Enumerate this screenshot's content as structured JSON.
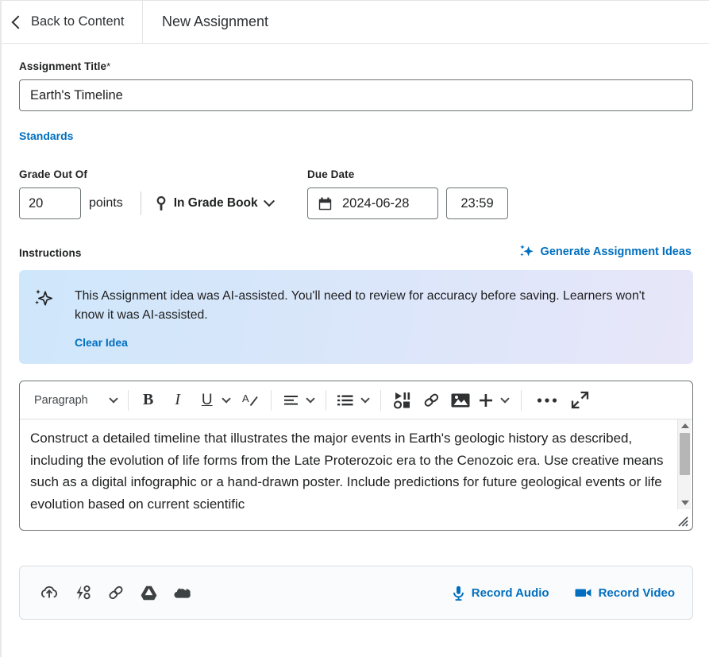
{
  "header": {
    "back_label": "Back to Content",
    "title": "New Assignment",
    "back_icon": "chevron-left-icon"
  },
  "form": {
    "title_label": "Assignment Title",
    "title_required_marker": "*",
    "title_value": "Earth's Timeline",
    "title_placeholder": "",
    "standards_link": "Standards",
    "grade_label": "Grade Out Of",
    "grade_value": "20",
    "points_label": "points",
    "gradebook_label": "In Grade Book",
    "gradebook_icon": "pin-icon",
    "gradebook_caret": "chevron-down-icon",
    "due_date_label": "Due Date",
    "due_date_value": "2024-06-28",
    "due_date_icon": "calendar-icon",
    "due_time_value": "23:59",
    "instructions_label": "Instructions",
    "generate_ideas_label": "Generate Assignment Ideas",
    "generate_ideas_icon": "sparkle-icon"
  },
  "ai_banner": {
    "icon": "sparkle-icon",
    "message": "This Assignment idea was AI-assisted. You'll need to review for accuracy before saving. Learners won't know it was AI-assisted.",
    "clear_link": "Clear Idea"
  },
  "editor": {
    "style_select_value": "Paragraph",
    "toolbar": [
      {
        "name": "bold-button",
        "label": "B"
      },
      {
        "name": "italic-button",
        "label": "I"
      },
      {
        "name": "underline-button",
        "label": "U"
      },
      {
        "name": "clear-formatting-button",
        "label": "A"
      },
      {
        "name": "align-button",
        "label": "align"
      },
      {
        "name": "list-button",
        "label": "list"
      },
      {
        "name": "insert-media-button",
        "label": "media"
      },
      {
        "name": "insert-link-button",
        "label": "link"
      },
      {
        "name": "insert-image-button",
        "label": "image"
      },
      {
        "name": "insert-more-button",
        "label": "+"
      },
      {
        "name": "overflow-menu-button",
        "label": "..."
      },
      {
        "name": "fullscreen-button",
        "label": "fullscreen"
      }
    ],
    "content": "Construct a detailed timeline that illustrates the major events in Earth's geologic history as described, including the evolution of life forms from the Late Proterozoic era to the Cenozoic era. Use creative means such as a digital infographic or a hand-drawn poster. Include predictions for future geological events or life evolution based on current scientific"
  },
  "attachments": {
    "icons": [
      {
        "name": "upload-cloud-icon"
      },
      {
        "name": "quicklink-icon"
      },
      {
        "name": "link-icon"
      },
      {
        "name": "google-drive-icon"
      },
      {
        "name": "onedrive-icon"
      }
    ],
    "record_audio_label": "Record Audio",
    "record_audio_icon": "microphone-icon",
    "record_video_label": "Record Video",
    "record_video_icon": "video-camera-icon"
  },
  "colors": {
    "link_blue": "#006fbf",
    "text": "#202122",
    "border": "#6e7477",
    "banner_from": "#cfe7fb",
    "banner_to": "#e8e6f9"
  }
}
